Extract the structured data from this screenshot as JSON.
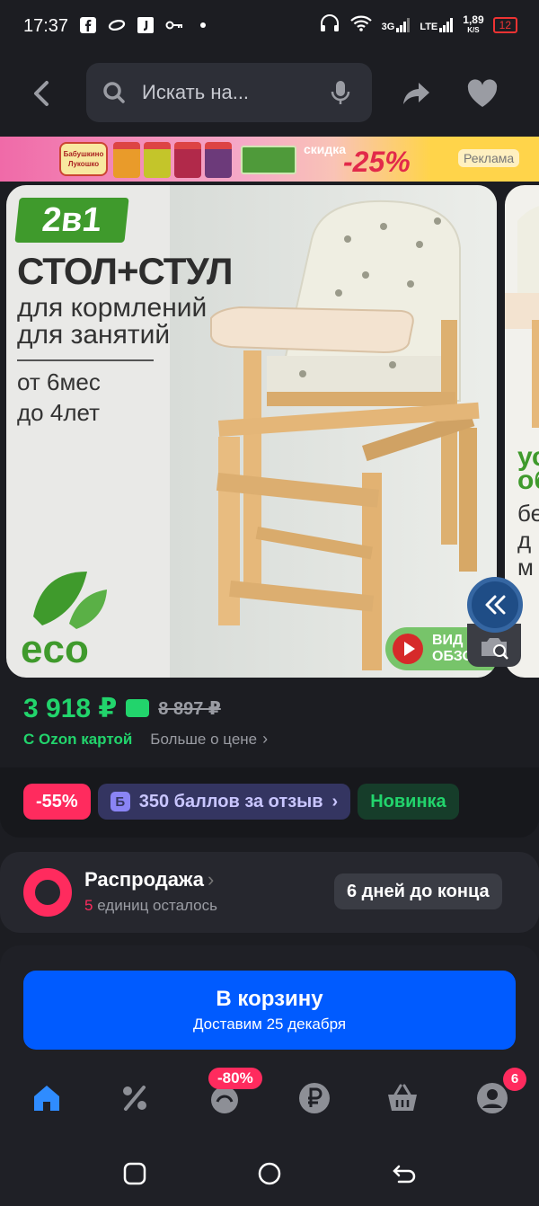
{
  "status_bar": {
    "time": "17:37",
    "network_3g": "3G",
    "network_lte": "LTE",
    "speed": "1,89",
    "speed_unit": "K/S",
    "battery": "12",
    "battery_color": "#e33333"
  },
  "top_bar": {
    "search_placeholder": "Искать на..."
  },
  "ad_banner": {
    "brand": "Бабушкино Лукошко",
    "discount_label": "скидка",
    "discount_value": "-25%",
    "ad_tag": "Реклама"
  },
  "product_image": {
    "badge": "2в1",
    "headline": "СТОЛ+СТУЛ",
    "subline_1": "для кормлений",
    "subline_2": "для занятий",
    "age_from": "от 6мес",
    "age_to": "до 4лет",
    "eco_logo": "eco",
    "video_label_1": "ВИД",
    "video_label_2": "ОБЗО",
    "next_card_text_1": "ус",
    "next_card_text_2": "об",
    "next_card_text_3": "бе",
    "next_card_text_4": "д",
    "next_card_text_5": "м"
  },
  "price": {
    "current": "3 918 ₽",
    "old": "8 897 ₽",
    "card_label": "С Ozon картой",
    "more_label": "Больше о цене",
    "accent_color": "#22d46c"
  },
  "tags": [
    {
      "label": "-55%"
    },
    {
      "icon_letter": "Б",
      "label": "350 баллов за отзыв"
    },
    {
      "label": "Новинка"
    }
  ],
  "sale": {
    "title": "Распродажа",
    "left_count": "5",
    "left_text": " единиц осталось",
    "days_left": "6 дней до конца"
  },
  "cart_button": {
    "label": "В корзину",
    "delivery": "Доставим 25 декабря",
    "color": "#005bff"
  },
  "tab_bar": {
    "sale_badge": "-80%",
    "profile_badge": "6",
    "active_color": "#2f8cff"
  }
}
